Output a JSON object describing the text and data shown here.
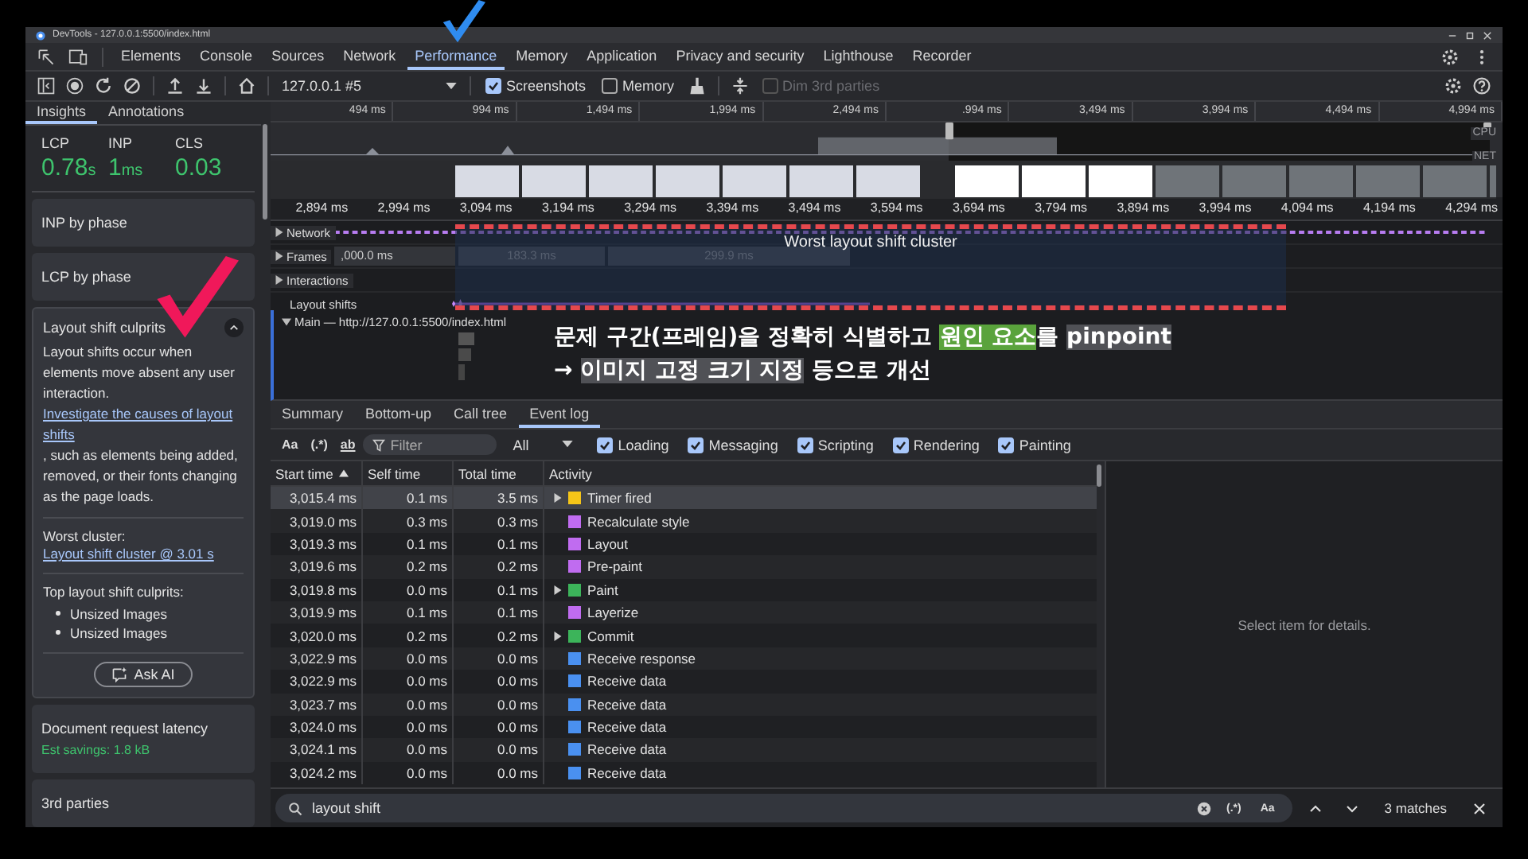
{
  "window": {
    "title": "DevTools - 127.0.0.1:5500/index.html"
  },
  "annotations": [
    {
      "kind": "check",
      "color": "#2f8cf0"
    },
    {
      "kind": "check",
      "color": "#f0185a"
    }
  ],
  "tabs": [
    {
      "label": "Elements",
      "selected": false
    },
    {
      "label": "Console",
      "selected": false
    },
    {
      "label": "Sources",
      "selected": false
    },
    {
      "label": "Network",
      "selected": false
    },
    {
      "label": "Performance",
      "selected": true
    },
    {
      "label": "Memory",
      "selected": false
    },
    {
      "label": "Application",
      "selected": false
    },
    {
      "label": "Privacy and security",
      "selected": false
    },
    {
      "label": "Lighthouse",
      "selected": false
    },
    {
      "label": "Recorder",
      "selected": false
    }
  ],
  "toolbar": {
    "recording": "127.0.0.1 #5",
    "options": [
      {
        "label": "Screenshots",
        "checked": true,
        "disabled": false
      },
      {
        "label": "Memory",
        "checked": false,
        "disabled": false
      },
      {
        "label": "Dim 3rd parties",
        "checked": false,
        "disabled": true
      }
    ]
  },
  "sidebar": {
    "tabs": [
      {
        "label": "Insights",
        "selected": true
      },
      {
        "label": "Annotations",
        "selected": false
      }
    ],
    "metrics": [
      {
        "label": "LCP",
        "value": "0.78",
        "unit": "s"
      },
      {
        "label": "INP",
        "value": "1",
        "unit": "ms"
      },
      {
        "label": "CLS",
        "value": "0.03"
      }
    ],
    "insights": [
      {
        "title": "INP by phase",
        "expanded": false
      },
      {
        "title": "LCP by phase",
        "expanded": false
      },
      {
        "title": "Layout shift culprits",
        "expanded": true,
        "description": {
          "before": "Layout shifts occur when elements move absent any user interaction. ",
          "link": "Investigate the causes of layout shifts",
          "after": ", such as elements being added, removed, or their fonts changing as the page loads."
        },
        "worst_label": "Worst cluster:",
        "worst_link": "Layout shift cluster @ 3.01 s",
        "culprits_label": "Top layout shift culprits:",
        "culprits": [
          "Unsized Images",
          "Unsized Images"
        ],
        "button": "Ask AI"
      },
      {
        "title": "Document request latency",
        "expanded": false,
        "savings": "Est savings: 1.8 kB"
      },
      {
        "title": "3rd parties",
        "expanded": false
      }
    ]
  },
  "timeline": {
    "overview_ticks": [
      "494 ms",
      "994 ms",
      "1,494 ms",
      "1,994 ms",
      "2,494 ms",
      ".994 ms",
      "3,494 ms",
      "3,994 ms",
      "4,494 ms",
      "4,994 ms"
    ],
    "lanes": [
      "CPU",
      "NET"
    ],
    "ruler_ticks": [
      "2,894 ms",
      "2,994 ms",
      "3,094 ms",
      "3,194 ms",
      "3,294 ms",
      "3,394 ms",
      "3,494 ms",
      "3,594 ms",
      "3,694 ms",
      "3,794 ms",
      "3,894 ms",
      "3,994 ms",
      "4,094 ms",
      "4,194 ms",
      "4,294 ms"
    ],
    "tracks": [
      {
        "label": "Network",
        "kind": "group"
      },
      {
        "label": "Frames",
        "kind": "frames"
      },
      {
        "label": "Interactions",
        "kind": "group"
      },
      {
        "label": "Layout shifts",
        "kind": "shifts"
      }
    ],
    "frames": [
      ",000.0 ms",
      "183.3 ms",
      "299.9 ms"
    ],
    "cluster_label": "Worst layout shift cluster",
    "main": {
      "label": "Main — http://127.0.0.1:5500/index.html",
      "expanded": true
    },
    "caption": [
      [
        {
          "text": "문제 구간(프레임)을 정확히 식별하고 "
        },
        {
          "text": "원인 요소",
          "color": "#5aa33c"
        },
        {
          "text": "를 "
        },
        {
          "text": "pinpoint",
          "color": "#505156"
        }
      ],
      [
        {
          "text": "→ "
        },
        {
          "text": "이미지 고정 크기 지정",
          "color": "#505156"
        },
        {
          "text": " 등으로 개선"
        }
      ]
    ]
  },
  "details": {
    "tabs": [
      {
        "label": "Summary",
        "selected": false
      },
      {
        "label": "Bottom-up",
        "selected": false
      },
      {
        "label": "Call tree",
        "selected": false
      },
      {
        "label": "Event log",
        "selected": true
      }
    ],
    "filter": {
      "toggles": [
        "Aa",
        "(.*)",
        "ab"
      ],
      "placeholder": "Filter",
      "dropdown": "All",
      "categories": [
        {
          "label": "Loading",
          "checked": true
        },
        {
          "label": "Messaging",
          "checked": true
        },
        {
          "label": "Scripting",
          "checked": true
        },
        {
          "label": "Rendering",
          "checked": true
        },
        {
          "label": "Painting",
          "checked": true
        }
      ]
    },
    "table": {
      "columns": [
        {
          "label": "Start time",
          "sorted": true
        },
        {
          "label": "Self time",
          "sorted": false
        },
        {
          "label": "Total time",
          "sorted": false
        },
        {
          "label": "Activity",
          "sorted": false
        }
      ],
      "rows": [
        {
          "start": "3,015.4 ms",
          "self": "0.1 ms",
          "total": "3.5 ms",
          "expandable": true,
          "name": "Timer fired",
          "color": "#f5c518",
          "selected": true
        },
        {
          "start": "3,019.0 ms",
          "self": "0.3 ms",
          "total": "0.3 ms",
          "expandable": false,
          "name": "Recalculate style",
          "color": "#c06cf0",
          "selected": false
        },
        {
          "start": "3,019.3 ms",
          "self": "0.1 ms",
          "total": "0.1 ms",
          "expandable": false,
          "name": "Layout",
          "color": "#c06cf0",
          "selected": false
        },
        {
          "start": "3,019.6 ms",
          "self": "0.2 ms",
          "total": "0.2 ms",
          "expandable": false,
          "name": "Pre-paint",
          "color": "#c06cf0",
          "selected": false
        },
        {
          "start": "3,019.8 ms",
          "self": "0.0 ms",
          "total": "0.1 ms",
          "expandable": true,
          "name": "Paint",
          "color": "#3cb45a",
          "selected": false
        },
        {
          "start": "3,019.9 ms",
          "self": "0.1 ms",
          "total": "0.1 ms",
          "expandable": false,
          "name": "Layerize",
          "color": "#c06cf0",
          "selected": false
        },
        {
          "start": "3,020.0 ms",
          "self": "0.2 ms",
          "total": "0.2 ms",
          "expandable": true,
          "name": "Commit",
          "color": "#3cb45a",
          "selected": false
        },
        {
          "start": "3,022.9 ms",
          "self": "0.0 ms",
          "total": "0.0 ms",
          "expandable": false,
          "name": "Receive response",
          "color": "#4a90f0",
          "selected": false
        },
        {
          "start": "3,022.9 ms",
          "self": "0.0 ms",
          "total": "0.0 ms",
          "expandable": false,
          "name": "Receive data",
          "color": "#4a90f0",
          "selected": false
        },
        {
          "start": "3,023.7 ms",
          "self": "0.0 ms",
          "total": "0.0 ms",
          "expandable": false,
          "name": "Receive data",
          "color": "#4a90f0",
          "selected": false
        },
        {
          "start": "3,024.0 ms",
          "self": "0.0 ms",
          "total": "0.0 ms",
          "expandable": false,
          "name": "Receive data",
          "color": "#4a90f0",
          "selected": false
        },
        {
          "start": "3,024.1 ms",
          "self": "0.0 ms",
          "total": "0.0 ms",
          "expandable": false,
          "name": "Receive data",
          "color": "#4a90f0",
          "selected": false
        },
        {
          "start": "3,024.2 ms",
          "self": "0.0 ms",
          "total": "0.0 ms",
          "expandable": false,
          "name": "Receive data",
          "color": "#4a90f0",
          "selected": false
        }
      ]
    },
    "empty_message": "Select item for details."
  },
  "search": {
    "value": "layout shift",
    "toggles": [
      "(.*)",
      "Aa"
    ],
    "matches": "3 matches"
  }
}
